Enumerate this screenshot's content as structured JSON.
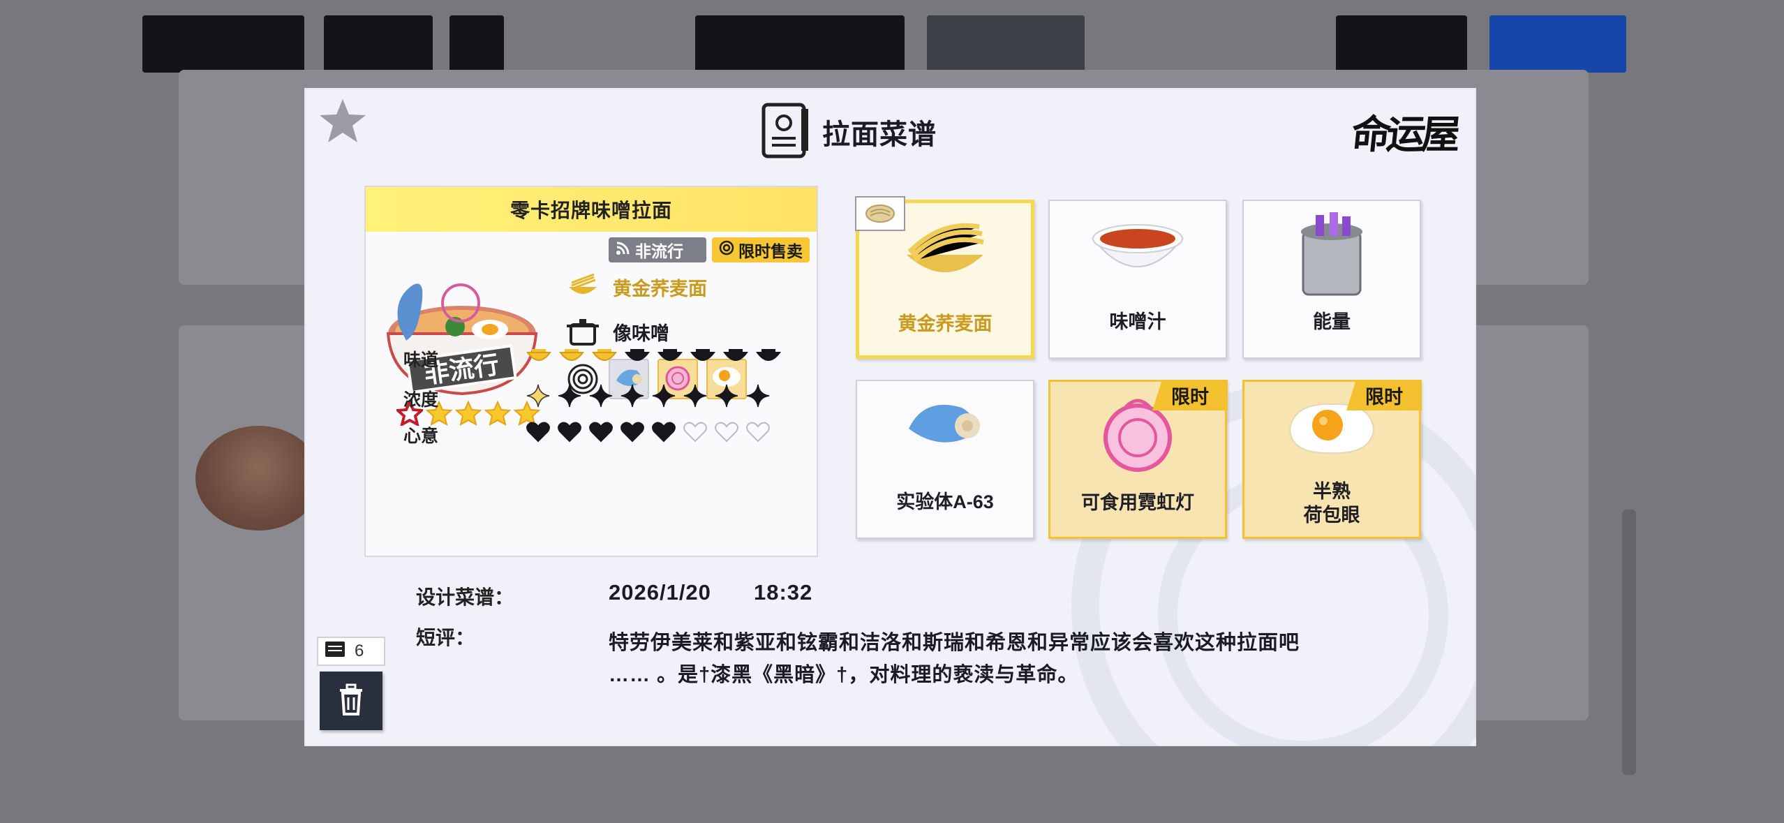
{
  "modal": {
    "title": "拉面菜谱",
    "logo_text": "命运屋"
  },
  "recipe": {
    "name": "零卡招牌味噌拉面",
    "tags": [
      {
        "label": "非流行",
        "style": "gray"
      },
      {
        "label": "限时售卖",
        "style": "yellow"
      }
    ],
    "bowl_stamp": "非流行",
    "rarity": {
      "filled": 5,
      "total": 5
    },
    "noodle": "黄金荞麦面",
    "soup": "像味噌",
    "stats": [
      {
        "label": "味道",
        "filled": 3,
        "total": 8,
        "icon": "bowl-icon"
      },
      {
        "label": "浓度",
        "filled": 1,
        "total": 8,
        "icon": "sparkle-icon"
      },
      {
        "label": "心意",
        "filled": 5,
        "total": 8,
        "icon": "heart-icon"
      }
    ]
  },
  "ingredients": [
    {
      "label": "黄金荞麦面",
      "icon": "noodles-icon",
      "selected": true,
      "limited": false
    },
    {
      "label": "味噌汁",
      "icon": "soup-icon",
      "selected": false,
      "limited": false
    },
    {
      "label": "能量",
      "icon": "energy-pot-icon",
      "selected": false,
      "limited": false
    },
    {
      "label": "实验体A-63",
      "icon": "sea-cucumber-icon",
      "selected": false,
      "limited": false
    },
    {
      "label": "可食用霓虹灯",
      "icon": "neon-lantern-icon",
      "selected": false,
      "limited": true
    },
    {
      "label": "半熟\n荷包眼",
      "icon": "fried-egg-icon",
      "selected": false,
      "limited": true
    }
  ],
  "limited_badge": "限时",
  "meta": {
    "design_label": "设计菜谱：",
    "design_date": "2026/1/20",
    "design_time": "18:32",
    "review_label": "短评：",
    "review_line1": "特劳伊美莱和紫亚和铉霸和洁洛和斯瑞和希恩和异常应该会喜欢这种拉面吧",
    "review_line2": "…… 。是†漆黑《黑暗》†，对料理的亵渎与革命。"
  },
  "recipe_count": "6",
  "colors": {
    "accent_yellow": "#f3c12f",
    "selected_text": "#c99a1d",
    "panel_bg": "#f1f2f9"
  }
}
